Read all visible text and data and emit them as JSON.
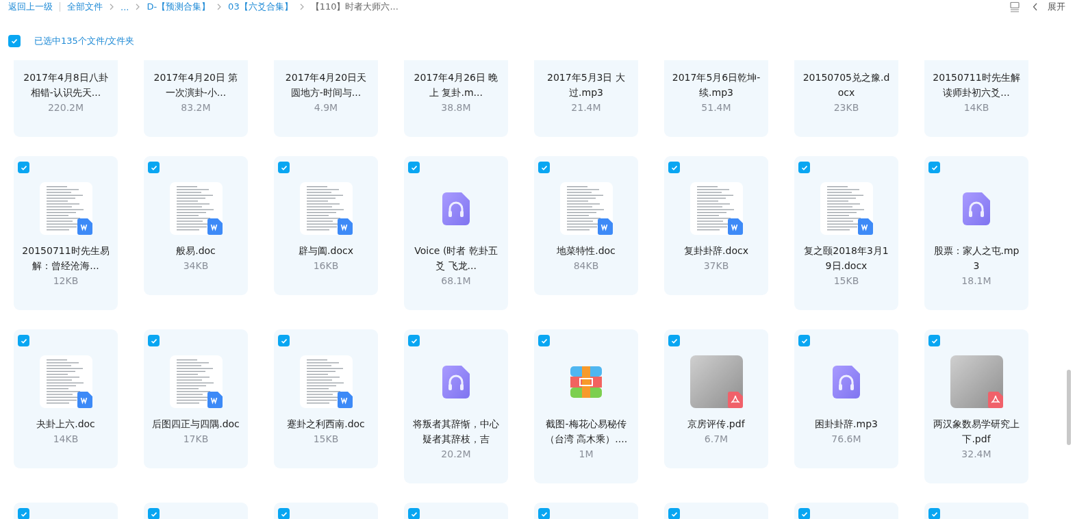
{
  "breadcrumbs": [
    {
      "label": "返回上一级",
      "kind": "link"
    },
    {
      "label": "全部文件",
      "kind": "link"
    },
    {
      "label": "...",
      "kind": "link"
    },
    {
      "label": "D-【预测合集】",
      "kind": "link"
    },
    {
      "label": "03【六爻合集】",
      "kind": "link"
    },
    {
      "label": "【110】时者大师六...",
      "kind": "current"
    }
  ],
  "expand_label": "展开",
  "selection": {
    "checked": true,
    "label": "已选中135个文件/文件夹"
  },
  "rows": [
    [
      {
        "name": "2017年4月8日八卦相错-认识先天...",
        "size": "220.2M"
      },
      {
        "name": "2017年4月20日 第一次演卦-小...",
        "size": "83.2M"
      },
      {
        "name": "2017年4月20日天圆地方-时间与...",
        "size": "4.9M"
      },
      {
        "name": "2017年4月26日 晚上 复卦.m...",
        "size": "38.8M"
      },
      {
        "name": "2017年5月3日 大过.mp3",
        "size": "21.4M"
      },
      {
        "name": "2017年5月6日乾坤-续.mp3",
        "size": "51.4M"
      },
      {
        "name": "20150705兑之豫.docx",
        "size": "23KB"
      },
      {
        "name": "20150711时先生解读师卦初六爻...",
        "size": "14KB"
      }
    ],
    [
      {
        "kind": "doc",
        "selected": true,
        "name": "20150711时先生易解：曾经沧海...",
        "size": "12KB"
      },
      {
        "kind": "doc",
        "selected": true,
        "name": "般易.doc",
        "size": "34KB"
      },
      {
        "kind": "doc",
        "selected": true,
        "name": "辟与阖.docx",
        "size": "16KB"
      },
      {
        "kind": "audio",
        "selected": true,
        "name": "Voice (时者 乾卦五爻 飞龙...",
        "size": "68.1M"
      },
      {
        "kind": "doc",
        "selected": true,
        "name": "地菜特性.doc",
        "size": "84KB"
      },
      {
        "kind": "doc",
        "selected": true,
        "name": "复卦卦辞.docx",
        "size": "37KB"
      },
      {
        "kind": "doc",
        "selected": true,
        "name": "复之颐2018年3月19日.docx",
        "size": "15KB"
      },
      {
        "kind": "audio",
        "selected": true,
        "name": "股票：家人之屯.mp3",
        "size": "18.1M"
      }
    ],
    [
      {
        "kind": "doc",
        "selected": true,
        "name": "夬卦上六.doc",
        "size": "14KB"
      },
      {
        "kind": "doc",
        "selected": true,
        "name": "后图四正与四隅.doc",
        "size": "17KB"
      },
      {
        "kind": "doc",
        "selected": true,
        "name": "蹇卦之利西南.doc",
        "size": "15KB"
      },
      {
        "kind": "audio",
        "selected": true,
        "name": "将叛者其辞惭，中心疑者其辞枝，吉",
        "size": "20.2M"
      },
      {
        "kind": "archive",
        "selected": true,
        "name": "截图-梅花心易秘传（台湾 高木乘）....",
        "size": "1M"
      },
      {
        "kind": "pdf",
        "selected": true,
        "name": "京房评传.pdf",
        "size": "6.7M"
      },
      {
        "kind": "audio",
        "selected": true,
        "name": "困卦卦辞.mp3",
        "size": "76.6M"
      },
      {
        "kind": "pdf",
        "selected": true,
        "name": "两汉象数易学研究上下.pdf",
        "size": "32.4M"
      }
    ],
    [
      {
        "selected": true
      },
      {
        "selected": true
      },
      {
        "selected": true
      },
      {
        "selected": true
      },
      {
        "selected": true
      },
      {
        "selected": true
      },
      {
        "selected": true
      },
      {
        "selected": true
      }
    ]
  ]
}
